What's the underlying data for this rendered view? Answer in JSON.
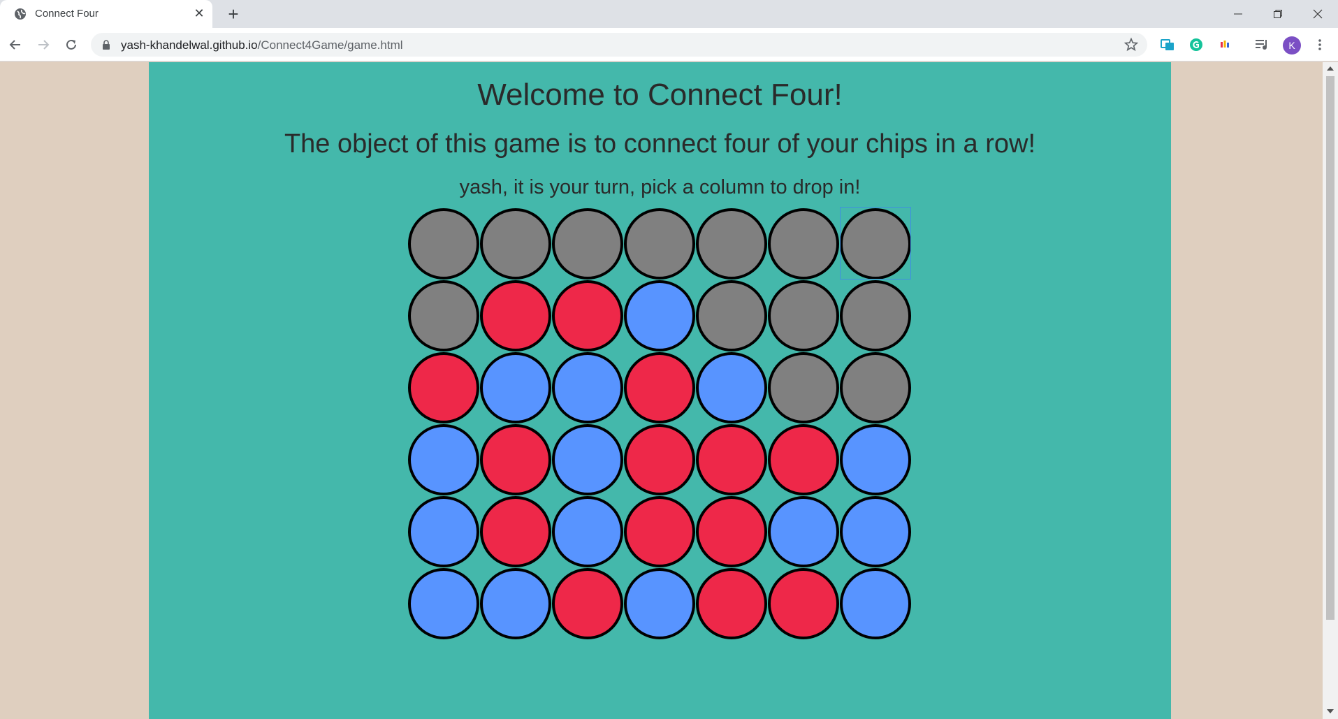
{
  "browser": {
    "tab_title": "Connect Four",
    "url_host": "yash-khandelwal.github.io",
    "url_path": "/Connect4Game/game.html",
    "avatar_letter": "K"
  },
  "page": {
    "heading": "Welcome to Connect Four!",
    "subheading": "The object of this game is to connect four of your chips in a row!",
    "turn_message": "yash, it is your turn, pick a column to drop in!"
  },
  "colors": {
    "content_bg": "#44b8ab",
    "page_bg": "#dfcfbf",
    "empty": "#808080",
    "player1": "#ee2849",
    "player2": "#5894ff"
  },
  "board": {
    "columns": 7,
    "rows": [
      [
        "empty",
        "empty",
        "empty",
        "empty",
        "empty",
        "empty",
        "empty"
      ],
      [
        "empty",
        "red",
        "red",
        "blue",
        "empty",
        "empty",
        "empty"
      ],
      [
        "red",
        "blue",
        "blue",
        "red",
        "blue",
        "empty",
        "empty"
      ],
      [
        "blue",
        "red",
        "blue",
        "red",
        "red",
        "red",
        "blue"
      ],
      [
        "blue",
        "red",
        "blue",
        "red",
        "red",
        "blue",
        "blue"
      ],
      [
        "blue",
        "blue",
        "red",
        "blue",
        "red",
        "red",
        "blue"
      ]
    ],
    "hovered_column": 7
  }
}
